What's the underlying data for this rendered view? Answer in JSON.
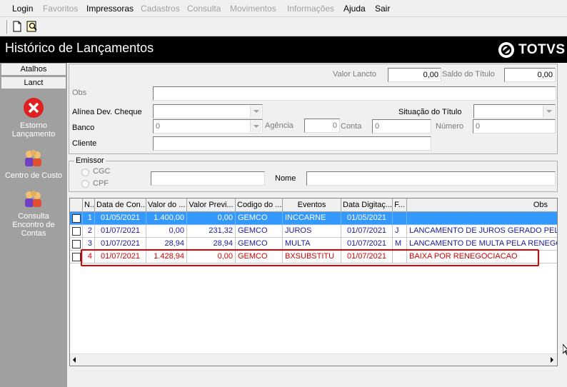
{
  "menu": {
    "items": [
      {
        "label": "Login",
        "enabled": true
      },
      {
        "label": "Favoritos",
        "enabled": false
      },
      {
        "label": "Impressoras",
        "enabled": true
      },
      {
        "label": "Cadastros",
        "enabled": false
      },
      {
        "label": "Consulta",
        "enabled": false
      },
      {
        "label": "Movimentos",
        "enabled": false
      },
      {
        "label": "Informações",
        "enabled": false
      },
      {
        "label": "Ajuda",
        "enabled": true
      },
      {
        "label": "Sair",
        "enabled": true
      }
    ]
  },
  "toolbar": {
    "icons": [
      "new-document-icon",
      "help-search-icon"
    ]
  },
  "window": {
    "title": "Histórico de Lançamentos",
    "brand": "TOTVS"
  },
  "sidebar": {
    "tabs": {
      "atalhos": "Atalhos",
      "lanct": "Lanct"
    },
    "actions": {
      "estorno": "Estorno Lançamento",
      "centro_custo": "Centro de Custo",
      "consulta_encontro": "Consulta Encontro de Contas"
    }
  },
  "form": {
    "valor_lancto_label": "Valor Lancto",
    "valor_lancto": "0,00",
    "saldo_titulo_label": "Saldo do Título",
    "saldo_titulo": "0,00",
    "obs_label": "Obs",
    "obs_value": "",
    "alinea_label": "Alínea Dev. Cheque",
    "alinea_value": "",
    "situacao_label": "Situação do Título",
    "situacao_value": "",
    "banco_label": "Banco",
    "banco_value": "0",
    "agencia_label": "Agência",
    "agencia_value": "0",
    "conta_label": "Conta",
    "conta_value": "0",
    "numero_label": "Número",
    "numero_value": "0",
    "cliente_label": "Cliente",
    "cliente_value": ""
  },
  "emissor": {
    "legend": "Emissor",
    "cgc_label": "CGC",
    "cpf_label": "CPF",
    "doc_value": "",
    "nome_label": "Nome",
    "nome_value": ""
  },
  "grid": {
    "columns": [
      "N..",
      "Data de Con...",
      "Valor do ...",
      "Valor Previ...",
      "Codigo do ...",
      "Eventos",
      "Data Digitaç...",
      "F...",
      "Obs"
    ],
    "rows": [
      {
        "n": "1",
        "data": "01/05/2021",
        "valor": "1.400,00",
        "previsto": "0,00",
        "codigo": "GEMCO",
        "evento": "INCCARNE",
        "digitacao": "01/05/2021",
        "f": "",
        "obs": "",
        "style": "selected"
      },
      {
        "n": "2",
        "data": "01/07/2021",
        "valor": "0,00",
        "previsto": "231,32",
        "codigo": "GEMCO",
        "evento": "JUROS",
        "digitacao": "01/07/2021",
        "f": "J",
        "obs": "LANCAMENTO DE JUROS GERADO PELA",
        "style": "blue"
      },
      {
        "n": "3",
        "data": "01/07/2021",
        "valor": "28,94",
        "previsto": "28,94",
        "codigo": "GEMCO",
        "evento": "MULTA",
        "digitacao": "01/07/2021",
        "f": "M",
        "obs": "LANCAMENTO DE MULTA PELA RENEGO",
        "style": "blue"
      },
      {
        "n": "4",
        "data": "01/07/2021",
        "valor": "1.428,94",
        "previsto": "0,00",
        "codigo": "GEMCO",
        "evento": "BXSUBSTITU",
        "digitacao": "01/07/2021",
        "f": "",
        "obs": "BAIXA POR RENEGOCIACAO",
        "style": "red"
      }
    ]
  },
  "colors": {
    "selection": "#3399ff",
    "blue_text": "#1a1aa0",
    "red_text": "#d40000",
    "highlight": "#e00000"
  }
}
